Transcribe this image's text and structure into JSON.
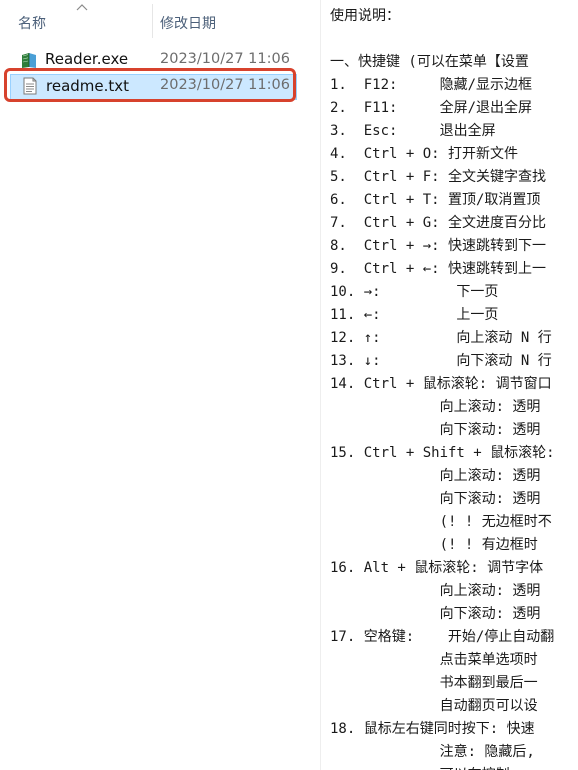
{
  "explorer": {
    "columns": {
      "name_header": "名称",
      "date_header": "修改日期",
      "sort_indicator": "chevron-up-icon"
    },
    "files": [
      {
        "icon": "reader-exe-icon",
        "name": "Reader.exe",
        "modified": "2023/10/27 11:06",
        "selected": false
      },
      {
        "icon": "text-file-icon",
        "name": "readme.txt",
        "modified": "2023/10/27 11:06",
        "selected": true
      }
    ],
    "highlight_color": "#d7422d",
    "selection_color": "#cce8ff"
  },
  "preview": {
    "lines": [
      "使用说明：",
      "",
      "一、快捷键 (可以在菜单【设置",
      "1.  F12:     隐藏/显示边框",
      "2.  F11:     全屏/退出全屏",
      "3.  Esc:     退出全屏",
      "4.  Ctrl + O: 打开新文件",
      "5.  Ctrl + F: 全文关键字查找",
      "6.  Ctrl + T: 置顶/取消置顶",
      "7.  Ctrl + G: 全文进度百分比",
      "8.  Ctrl + →: 快速跳转到下一",
      "9.  Ctrl + ←: 快速跳转到上一",
      "10. →:         下一页",
      "11. ←:         上一页",
      "12. ↑:         向上滚动 N 行",
      "13. ↓:         向下滚动 N 行",
      "14. Ctrl + 鼠标滚轮: 调节窗口",
      "             向上滚动: 透明",
      "             向下滚动: 透明",
      "15. Ctrl + Shift + 鼠标滚轮:",
      "             向上滚动: 透明",
      "             向下滚动: 透明",
      "             (! ! 无边框时不",
      "             (! ! 有边框时",
      "16. Alt + 鼠标滚轮: 调节字体",
      "             向上滚动: 透明",
      "             向下滚动: 透明",
      "17. 空格键:    开始/停止自动翻",
      "             点击菜单选项时",
      "             书本翻到最后一",
      "             自动翻页可以设",
      "18. 鼠标左右键同时按下: 快速",
      "             注意: 隐藏后,",
      "             可以在控制"
    ]
  }
}
